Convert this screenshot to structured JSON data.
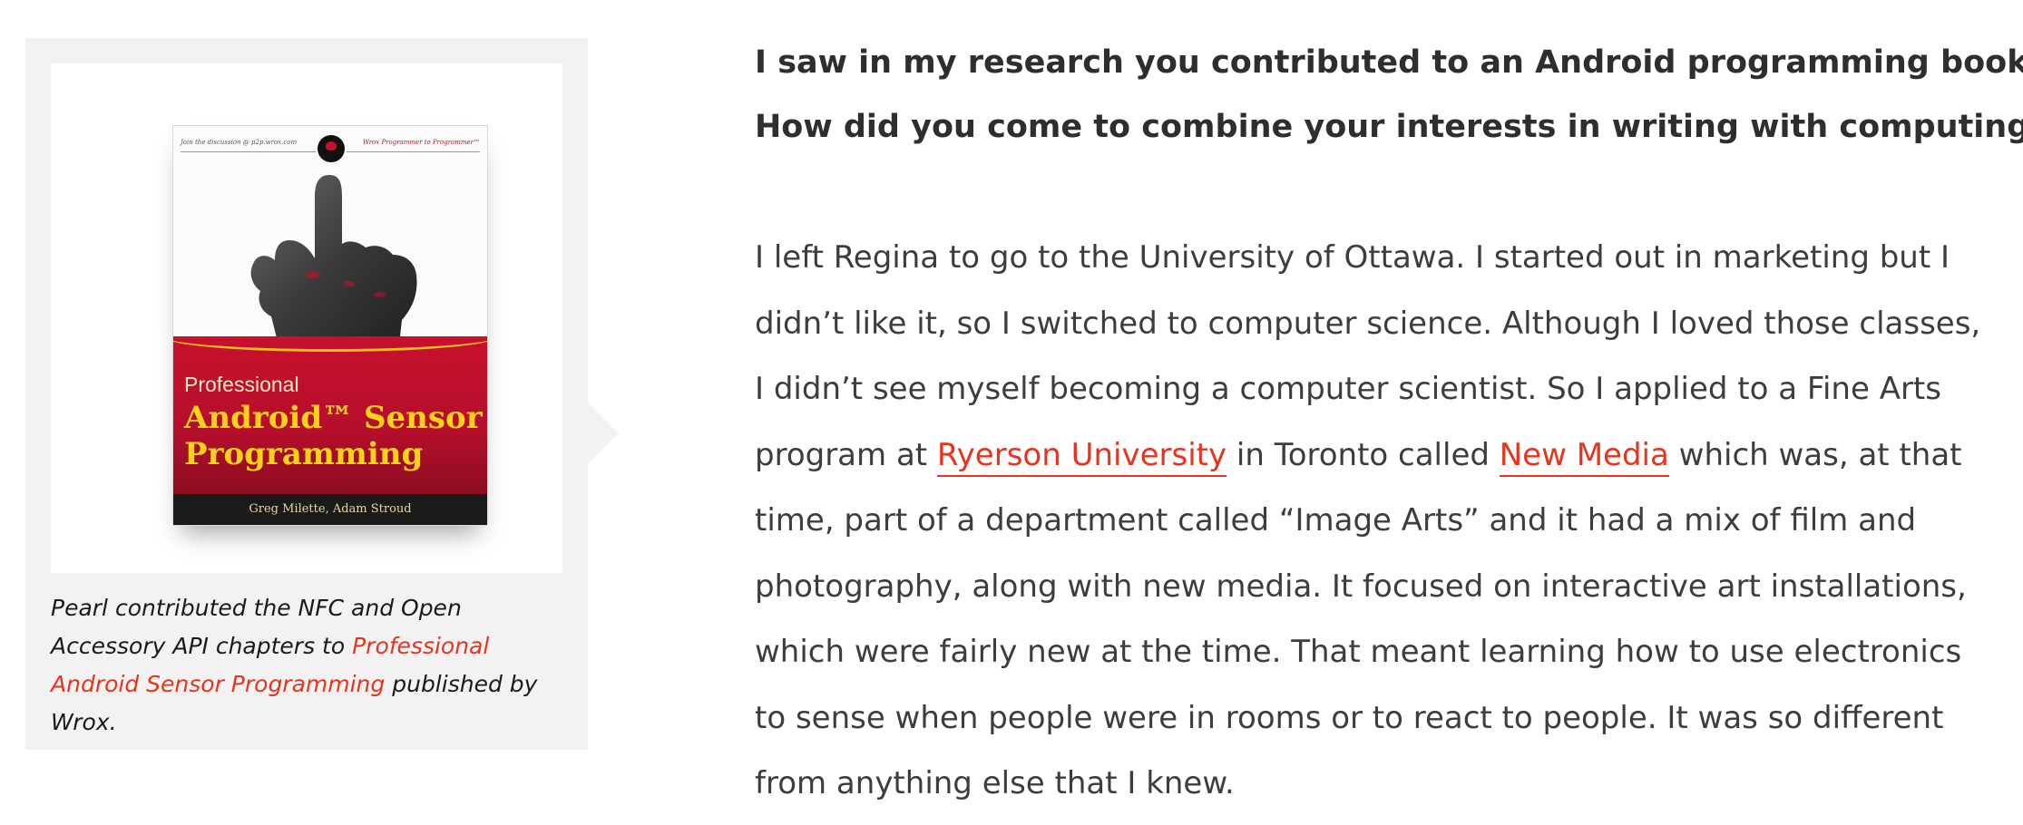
{
  "figure": {
    "book": {
      "top_left_text": "Join the discussion @ p2p.wrox.com",
      "top_right_text": "Wrox Programmer to Programmer™",
      "pre_title": "Professional",
      "title": "Android™ Sensor\nProgramming",
      "authors": "Greg Milette, Adam Stroud"
    },
    "caption": {
      "before": "Pearl contributed the NFC and Open Accessory API chapters to ",
      "link": "Professional Android Sensor Programming",
      "after": " published by Wrox."
    }
  },
  "article": {
    "question_lines": [
      "I saw in my research you contributed to an Android programming book.",
      "How did you come to combine your interests in writing with computing?"
    ],
    "answer": {
      "line1": "I left Regina to go to the University of Ottawa. I started out in marketing but I",
      "line2": "didn’t like it, so I switched to computer science. Although I loved those classes,",
      "line3": "I didn’t see myself becoming a computer scientist. So I applied to a Fine Arts",
      "line4_a": "program at ",
      "link1": "Ryerson University",
      "line4_b": " in Toronto called ",
      "link2": "New Media",
      "line4_c": " which was, at that",
      "line5": "time, part of a department called “Image Arts” and it had a mix of film and",
      "line6": "photography, along with new media. It focused on interactive art installations,",
      "line7": "which were fairly new at the time. That meant learning how to use electronics",
      "line8": "to sense when people were in rooms or to react to people. It was so different",
      "line9": "from anything else that I knew."
    },
    "link_color": "#e8331d"
  }
}
